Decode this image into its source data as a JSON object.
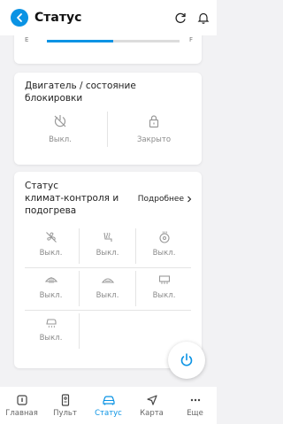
{
  "header": {
    "title": "Статус"
  },
  "fuel": {
    "empty_label": "E",
    "full_label": "F",
    "level": 0.5
  },
  "engine_card": {
    "title_line1": "Двигатель / состояние",
    "title_line2": "блокировки",
    "items": [
      {
        "icon": "engine-off-icon",
        "label": "Выкл."
      },
      {
        "icon": "lock-closed-icon",
        "label": "Закрыто"
      }
    ]
  },
  "climate_card": {
    "title_line1": "Статус",
    "title_line2": "климат-контроля и",
    "title_line3": "подогрева",
    "more_label": "Подробнее",
    "items": [
      {
        "icon": "fan-off-icon",
        "label": "Выкл."
      },
      {
        "icon": "seat-heater-icon",
        "label": "Выкл."
      },
      {
        "icon": "steering-wheel-heater-icon",
        "label": "Выкл."
      },
      {
        "icon": "front-defrost-icon",
        "label": "Выкл."
      },
      {
        "icon": "windshield-heater-icon",
        "label": "Выкл."
      },
      {
        "icon": "rear-defrost-icon",
        "label": "Выкл."
      },
      {
        "icon": "mirror-heater-icon",
        "label": "Выкл."
      }
    ]
  },
  "tabs": [
    {
      "label": "Главная",
      "icon": "home-icon"
    },
    {
      "label": "Пульт",
      "icon": "remote-icon"
    },
    {
      "label": "Статус",
      "icon": "car-icon",
      "active": true
    },
    {
      "label": "Карта",
      "icon": "navigation-icon"
    },
    {
      "label": "Еще",
      "icon": "more-icon"
    }
  ],
  "colors": {
    "accent": "#0a93e4",
    "muted": "#8b8b8b"
  }
}
